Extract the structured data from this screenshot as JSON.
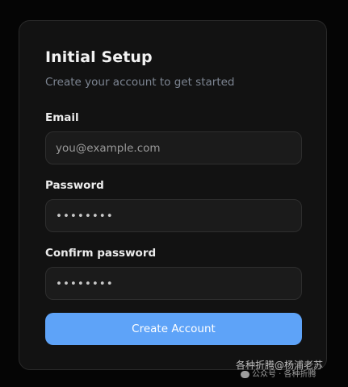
{
  "form": {
    "title": "Initial Setup",
    "subtitle": "Create your account to get started",
    "email": {
      "label": "Email",
      "placeholder": "you@example.com",
      "value": ""
    },
    "password": {
      "label": "Password",
      "value": "••••••••"
    },
    "confirm_password": {
      "label": "Confirm password",
      "value": "••••••••"
    },
    "submit_label": "Create Account"
  },
  "watermark": {
    "line1": "各种折腾@杨浦老苏",
    "line2": "公众号 · 各种折腾",
    "icon": "wechat-icon"
  },
  "colors": {
    "background": "#050505",
    "card": "#121212",
    "input_bg": "#1b1b1b",
    "accent": "#5ea3f8",
    "subtitle": "#7d8592"
  }
}
